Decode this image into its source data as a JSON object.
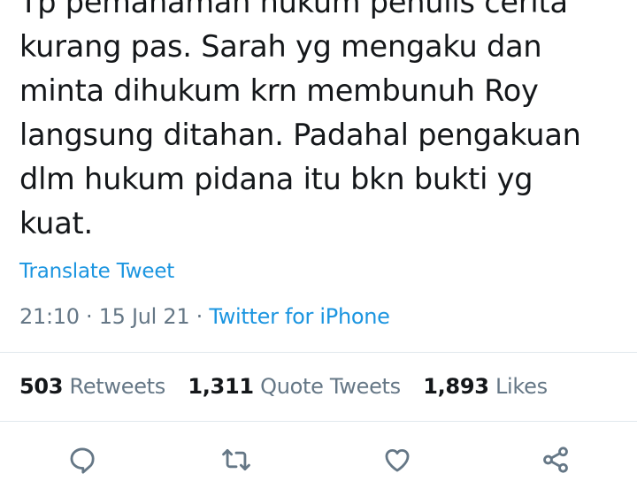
{
  "tweet": {
    "lines": [
      "Tp pemahaman hukum penulis cerita",
      "kurang pas. Sarah yg mengaku dan",
      "minta dihukum krn membunuh Roy",
      "langsung ditahan. Padahal pengakuan",
      "dlm hukum pidana itu bkn bukti yg",
      "kuat."
    ],
    "translate_label": "Translate Tweet",
    "time": "21:10",
    "separator": "·",
    "date": "15 Jul 21",
    "source": "Twitter for iPhone"
  },
  "stats": {
    "retweets": {
      "count": "503",
      "label": "Retweets"
    },
    "quote_tweets": {
      "count": "1,311",
      "label": "Quote Tweets"
    },
    "likes": {
      "count": "1,893",
      "label": "Likes"
    }
  },
  "actions": [
    {
      "icon": "reply-icon"
    },
    {
      "icon": "retweet-icon"
    },
    {
      "icon": "like-icon"
    },
    {
      "icon": "share-icon"
    }
  ],
  "colors": {
    "text": "#14171a",
    "secondary": "#657786",
    "link": "#1b95e0",
    "divider": "#e1e8ed"
  }
}
